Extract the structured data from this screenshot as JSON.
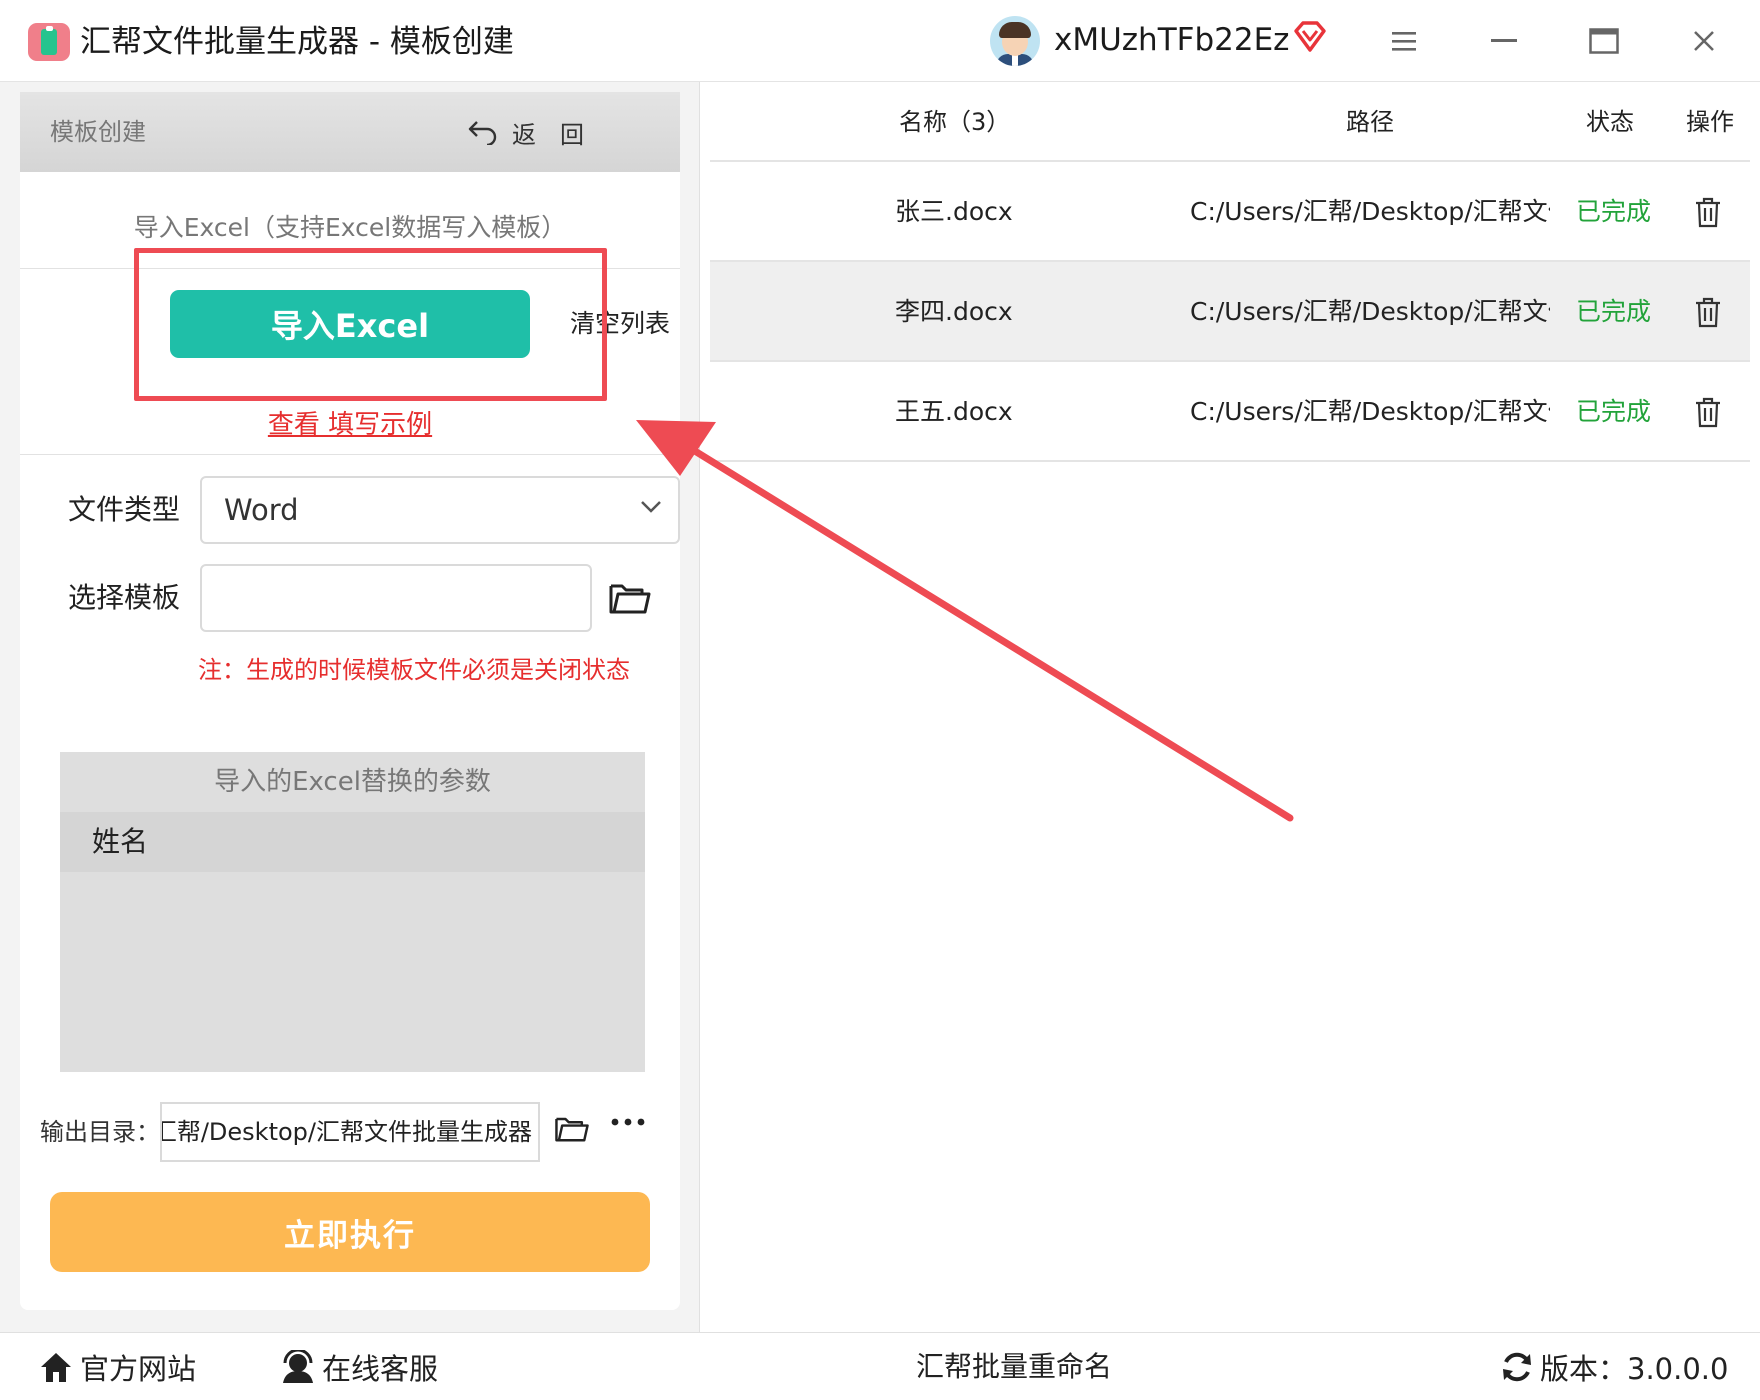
{
  "app": {
    "title": "汇帮文件批量生成器 - 模板创建",
    "username": "xMUzhTFb22Ez"
  },
  "left_panel": {
    "header_title": "模板创建",
    "back_label": "返回",
    "import_hint": "导入Excel（支持Excel数据写入模板）",
    "import_button": "导入Excel",
    "clear_button": "清空列表",
    "example_link": "查看 填写示例",
    "file_type_label": "文件类型",
    "file_type_value": "Word",
    "template_label": "选择模板",
    "template_value": "",
    "template_note": "注：生成的时候模板文件必须是关闭状态",
    "params_title": "导入的Excel替换的参数",
    "params": [
      "姓名"
    ],
    "output_label": "输出目录：",
    "output_path": "汇帮/Desktop/汇帮文件批量生成器",
    "run_button": "立即执行"
  },
  "table": {
    "columns": {
      "name": "名称（3）",
      "path": "路径",
      "status": "状态",
      "op": "操作"
    },
    "rows": [
      {
        "name": "张三.docx",
        "path": "C:/Users/汇帮/Desktop/汇帮文件",
        "status": "已完成"
      },
      {
        "name": "李四.docx",
        "path": "C:/Users/汇帮/Desktop/汇帮文件",
        "status": "已完成"
      },
      {
        "name": "王五.docx",
        "path": "C:/Users/汇帮/Desktop/汇帮文件",
        "status": "已完成"
      }
    ]
  },
  "footer": {
    "site": "官方网站",
    "service": "在线客服",
    "rename": "汇帮批量重命名",
    "version": "版本：3.0.0.0"
  },
  "colors": {
    "primary_teal": "#1fbfa8",
    "run_orange": "#fdb852",
    "highlight_red": "#ee4b53",
    "status_green": "#22a33a",
    "note_red": "#e62e2e"
  },
  "icons": [
    "app-logo",
    "avatar",
    "vip-diamond-icon",
    "menu-icon",
    "minimize-icon",
    "maximize-icon",
    "close-icon",
    "back-arrow-icon",
    "chevron-down-icon",
    "folder-icon",
    "more-icon",
    "trash-icon",
    "home-icon",
    "service-icon",
    "refresh-icon"
  ]
}
